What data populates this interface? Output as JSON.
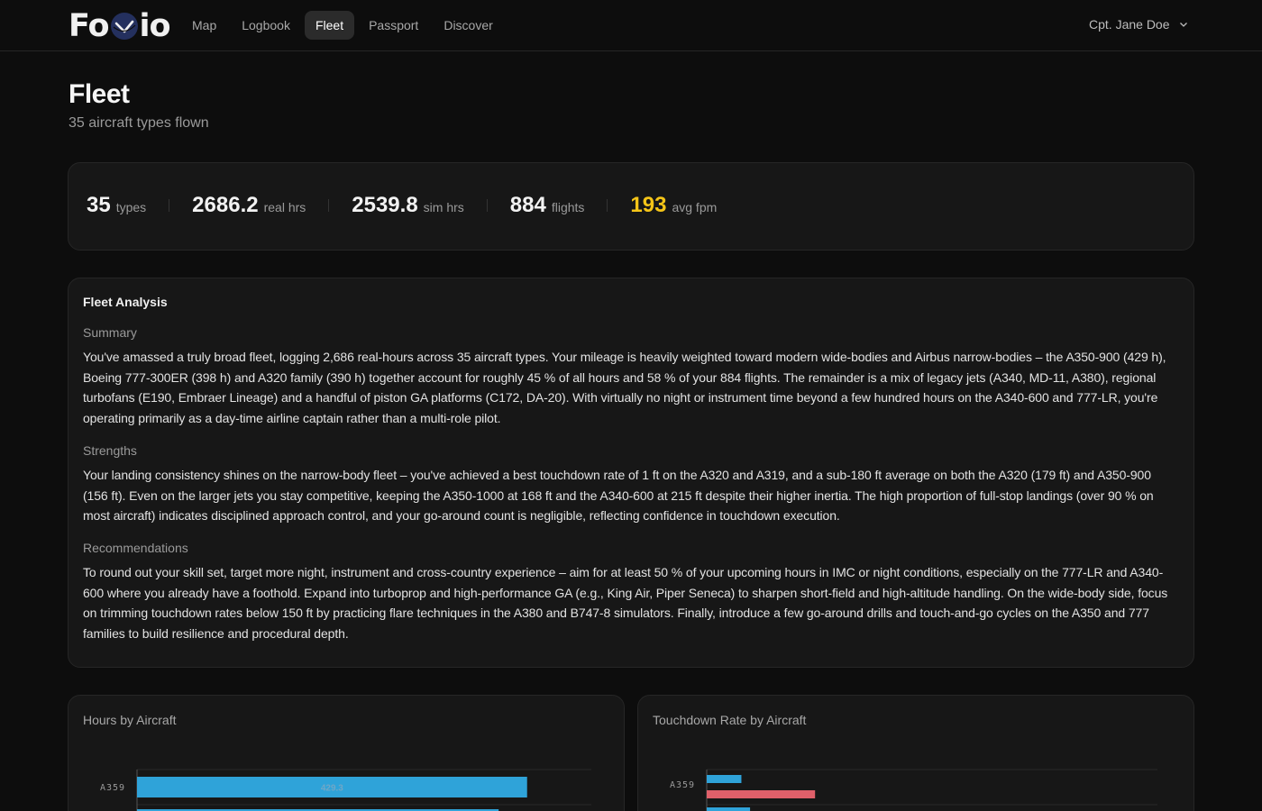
{
  "nav": {
    "logo_prefix": "Fo",
    "logo_suffix": "io",
    "links": [
      "Map",
      "Logbook",
      "Fleet",
      "Passport",
      "Discover"
    ],
    "active": "Fleet",
    "user": "Cpt. Jane Doe"
  },
  "header": {
    "title": "Fleet",
    "subtitle": "35 aircraft types flown"
  },
  "stats": [
    {
      "value": "35",
      "label": "types"
    },
    {
      "value": "2686.2",
      "label": "real hrs"
    },
    {
      "value": "2539.8",
      "label": "sim hrs"
    },
    {
      "value": "884",
      "label": "flights"
    },
    {
      "value": "193",
      "label": "avg fpm"
    }
  ],
  "colors": {
    "accent": "#f5c518",
    "bar_blue": "#2fa3d9",
    "bar_red": "#e0606a",
    "card_bg": "#171717"
  },
  "analysis": {
    "title": "Fleet Analysis",
    "summary_head": "Summary",
    "summary": "You've amassed a truly broad fleet, logging 2,686 real-hours across 35 aircraft types. Your mileage is heavily weighted toward modern wide-bodies and Airbus narrow-bodies – the A350-900 (429 h), Boeing 777-300ER (398 h) and A320 family (390 h) together account for roughly 45 % of all hours and 58 % of your 884 flights. The remainder is a mix of legacy jets (A340, MD-11, A380), regional turbofans (E190, Embraer Lineage) and a handful of piston GA platforms (C172, DA-20). With virtually no night or instrument time beyond a few hundred hours on the A340-600 and 777-LR, you're operating primarily as a day-time airline captain rather than a multi-role pilot.",
    "strengths_head": "Strengths",
    "strengths": "Your landing consistency shines on the narrow-body fleet – you've achieved a best touchdown rate of 1 ft on the A320 and A319, and a sub-180 ft average on both the A320 (179 ft) and A350-900 (156 ft). Even on the larger jets you stay competitive, keeping the A350-1000 at 168 ft and the A340-600 at 215 ft despite their higher inertia. The high proportion of full-stop landings (over 90 % on most aircraft) indicates disciplined approach control, and your go-around count is negligible, reflecting confidence in touchdown execution.",
    "recommendations_head": "Recommendations",
    "recommendations": "To round out your skill set, target more night, instrument and cross-country experience – aim for at least 50 % of your upcoming hours in IMC or night conditions, especially on the 777-LR and A340-600 where you already have a foothold. Expand into turboprop and high-performance GA (e.g., King Air, Piper Seneca) to sharpen short-field and high-altitude handling. On the wide-body side, focus on trimming touchdown rates below 150 ft by practicing flare techniques in the A380 and B747-8 simulators. Finally, introduce a few go-around drills and touch-and-go cycles on the A350 and 777 families to build resilience and procedural depth."
  },
  "chart_data": [
    {
      "type": "bar",
      "title": "Hours by Aircraft",
      "orientation": "horizontal",
      "categories": [
        "A359"
      ],
      "values": [
        429.3
      ],
      "data_labels": [
        "429.3"
      ],
      "next_bar_partial_value": 398,
      "xlim": [
        0,
        500
      ]
    },
    {
      "type": "bar",
      "title": "Touchdown Rate by Aircraft",
      "orientation": "horizontal",
      "categories": [
        "A359"
      ],
      "series": [
        {
          "color": "#2fa3d9",
          "values": [
            40
          ]
        },
        {
          "color": "#e0606a",
          "values": [
            125
          ]
        }
      ],
      "next_bar_partial_value": 50,
      "xlim": [
        0,
        520
      ]
    }
  ]
}
